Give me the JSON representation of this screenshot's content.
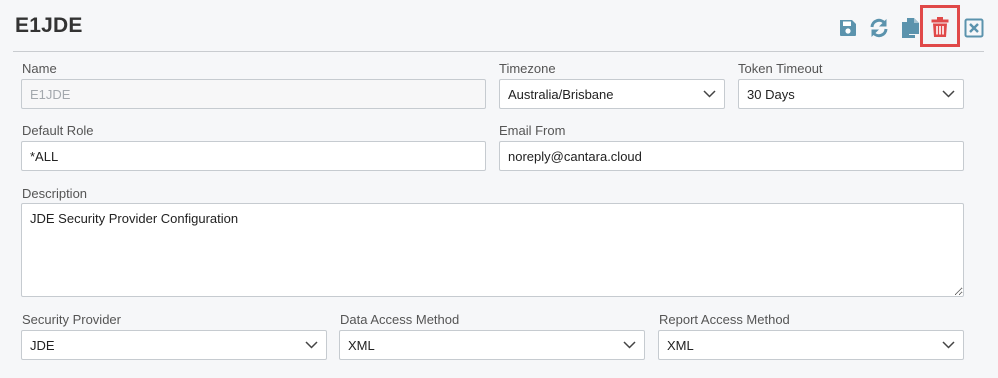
{
  "header": {
    "title": "E1JDE"
  },
  "toolbar": {
    "icons": [
      "save-icon",
      "refresh-icon",
      "copy-icon",
      "trash-icon",
      "close-icon"
    ],
    "accent_color": "#5b93ad",
    "delete_color": "#e04848"
  },
  "form": {
    "name": {
      "label": "Name",
      "value": "E1JDE"
    },
    "timezone": {
      "label": "Timezone",
      "value": "Australia/Brisbane"
    },
    "token_timeout": {
      "label": "Token Timeout",
      "value": "30 Days"
    },
    "default_role": {
      "label": "Default Role",
      "value": "*ALL"
    },
    "email_from": {
      "label": "Email From",
      "value": "noreply@cantara.cloud"
    },
    "description": {
      "label": "Description",
      "value": "JDE Security Provider Configuration"
    },
    "security_provider": {
      "label": "Security Provider",
      "value": "JDE"
    },
    "data_access_method": {
      "label": "Data Access Method",
      "value": "XML"
    },
    "report_access_method": {
      "label": "Report Access Method",
      "value": "XML"
    }
  }
}
